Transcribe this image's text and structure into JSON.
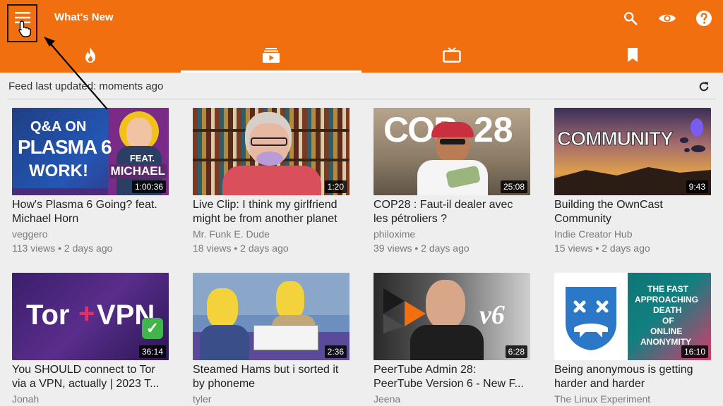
{
  "app": {
    "title": "What's New",
    "actions": [
      "search-icon",
      "eye-icon",
      "help-icon"
    ]
  },
  "colors": {
    "primary": "#f26f10",
    "background": "#eeeeee"
  },
  "tabs": [
    {
      "icon": "fire-icon",
      "active": false
    },
    {
      "icon": "subscriptions-icon",
      "active": true
    },
    {
      "icon": "tv-icon",
      "active": false
    },
    {
      "icon": "bookmark-icon",
      "active": false
    }
  ],
  "feed": {
    "status": "Feed last updated: moments ago"
  },
  "videos": [
    {
      "title_line1": "How's Plasma 6 Going? feat.",
      "title_line2": "Michael Horn",
      "channel": "veggero",
      "meta": "113 views • 2 days ago",
      "duration": "1:00:36",
      "thumb": {
        "line1": "Q&A ON",
        "line2": "PLASMA 6",
        "line3": "WORK!",
        "line4": "FEAT.",
        "line5": "MICHAEL"
      }
    },
    {
      "title_line1": "Live Clip: I think my girlfriend",
      "title_line2": "might be from another planet",
      "channel": "Mr. Funk E. Dude",
      "meta": "18 views • 2 days ago",
      "duration": "1:20"
    },
    {
      "title_line1": "COP28 : Faut-il dealer avec",
      "title_line2": "les pétroliers ?",
      "channel": "philoxime",
      "meta": "39 views • 2 days ago",
      "duration": "25:08",
      "thumb": {
        "line1": "COP",
        "line2": "28"
      }
    },
    {
      "title_line1": "Building the OwnCast",
      "title_line2": "Community",
      "channel": "Indie Creator Hub",
      "meta": "15 views • 2 days ago",
      "duration": "9:43",
      "thumb": {
        "line1": "COMMUNITY"
      }
    },
    {
      "title_line1": "You SHOULD connect to Tor",
      "title_line2": "via a VPN, actually | 2023 T...",
      "channel": "Jonah",
      "meta": "",
      "duration": "36:14",
      "thumb": {
        "line1": "Tor",
        "line2": "+",
        "line3": "VPN"
      }
    },
    {
      "title_line1": "Steamed Hams but i sorted it",
      "title_line2": "by phoneme",
      "channel": "tyler",
      "meta": "",
      "duration": "2:36"
    },
    {
      "title_line1": "PeerTube Admin 28:",
      "title_line2": "PeerTube Version 6 - New F...",
      "channel": "Jeena",
      "meta": "",
      "duration": "6:28",
      "thumb": {
        "line1": "v6"
      }
    },
    {
      "title_line1": "Being anonymous is getting",
      "title_line2": "harder and harder",
      "channel": "The Linux Experiment",
      "meta": "",
      "duration": "16:10",
      "thumb": {
        "line1": "THE FAST",
        "line2": "APPROACHING",
        "line3": "DEATH",
        "line4": "OF",
        "line5": "ONLINE",
        "line6": "ANONYMITY"
      }
    }
  ]
}
